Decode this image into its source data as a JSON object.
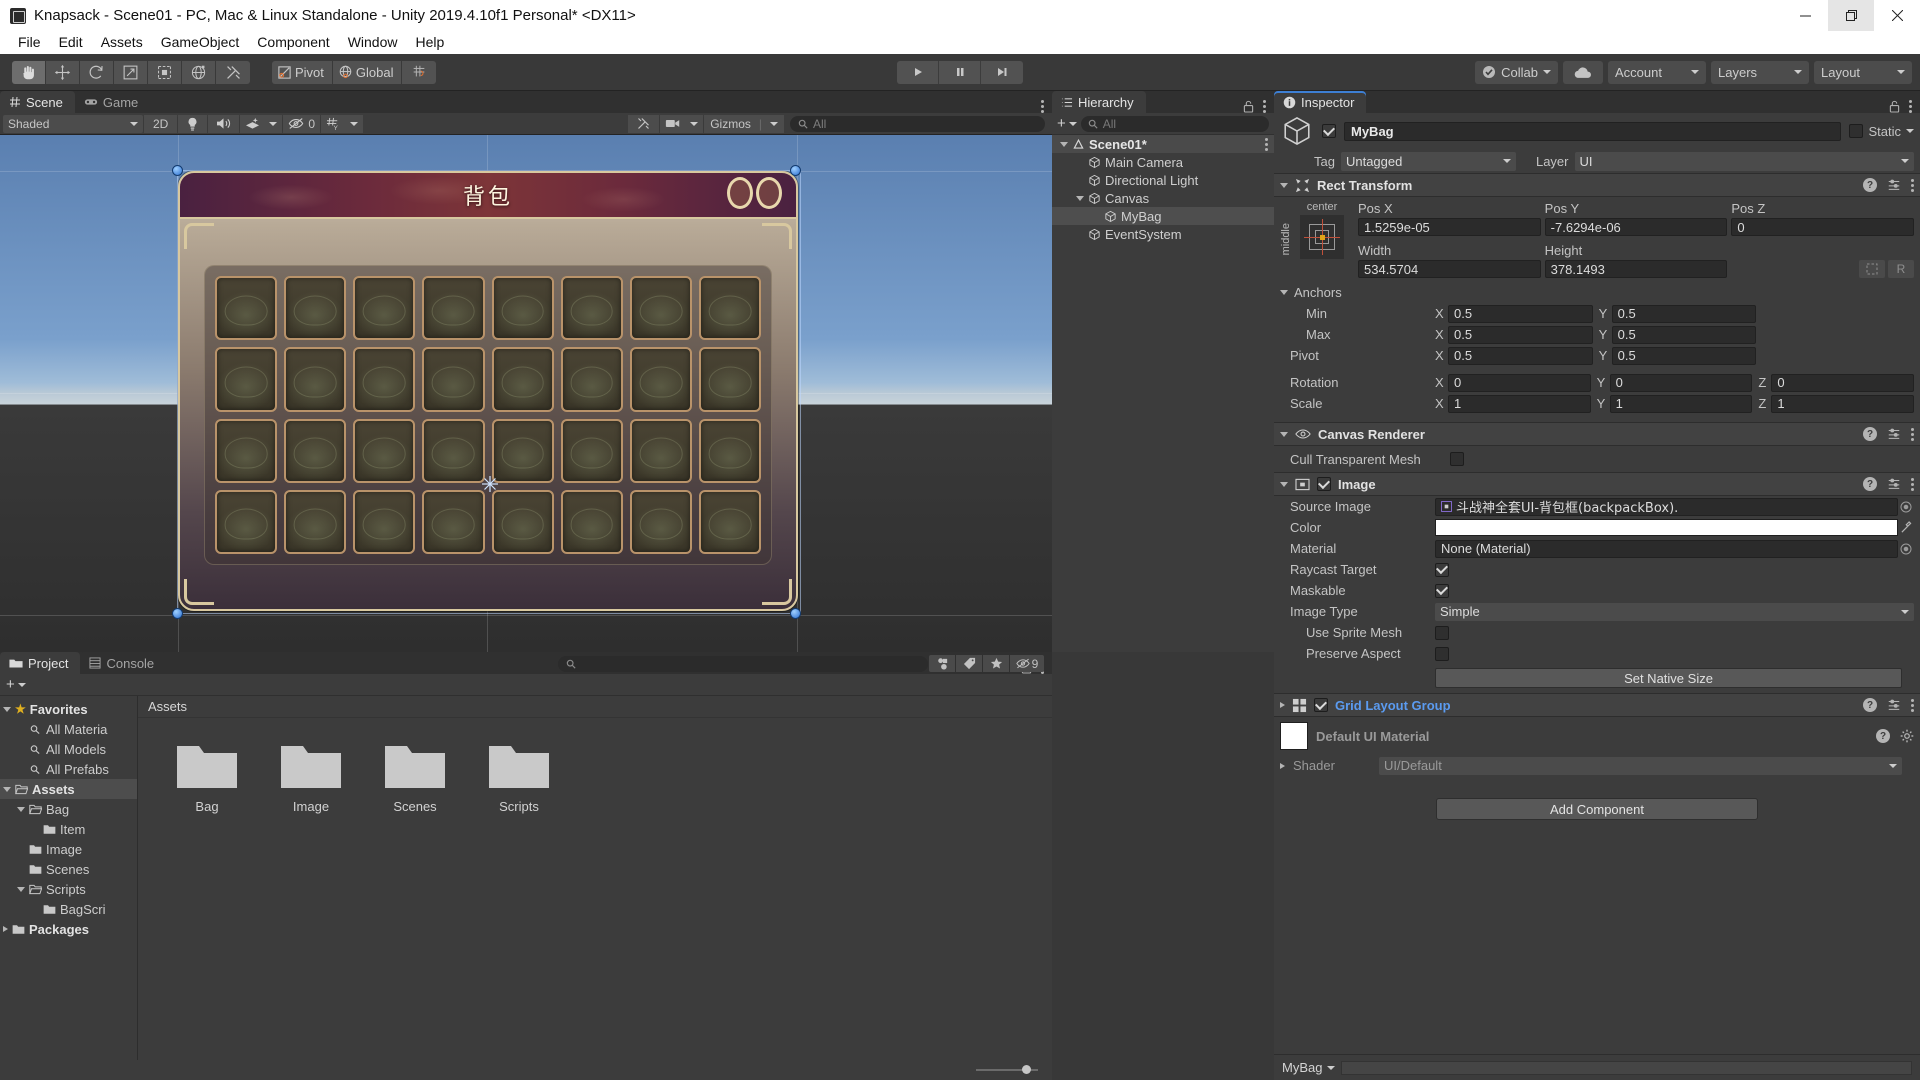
{
  "window": {
    "title": "Knapsack - Scene01 - PC, Mac & Linux Standalone - Unity 2019.4.10f1 Personal* <DX11>",
    "app_icon": "unity-icon",
    "minimize": "minimize-icon",
    "restore": "restore-icon",
    "close": "close-icon"
  },
  "menubar": {
    "items": [
      "File",
      "Edit",
      "Assets",
      "GameObject",
      "Component",
      "Window",
      "Help"
    ]
  },
  "toolbar": {
    "tools": [
      {
        "name": "hand-tool",
        "icon": "hand-icon",
        "active": true
      },
      {
        "name": "move-tool",
        "icon": "move-icon",
        "active": false
      },
      {
        "name": "rotate-tool",
        "icon": "rotate-icon",
        "active": false
      },
      {
        "name": "scale-tool",
        "icon": "scale-icon",
        "active": false
      },
      {
        "name": "rect-tool",
        "icon": "rect-icon",
        "active": false
      },
      {
        "name": "transform-tool",
        "icon": "transform-icon",
        "active": false
      },
      {
        "name": "custom-editor-tool",
        "icon": "wrench-icon",
        "active": false
      }
    ],
    "pivot_label": "Pivot",
    "global_label": "Global",
    "grid_snap_icon": "grid-snap-icon",
    "play": "play-icon",
    "pause": "pause-icon",
    "step": "step-icon",
    "collab_label": "Collab",
    "cloud_icon": "cloud-icon",
    "account_label": "Account",
    "layers_label": "Layers",
    "layout_label": "Layout"
  },
  "scene": {
    "tabs": [
      {
        "label": "Scene",
        "icon": "grid-hash-icon",
        "active": true
      },
      {
        "label": "Game",
        "icon": "gamepad-icon",
        "active": false
      }
    ],
    "draw_mode": "Shaded",
    "mode_2d": "2D",
    "lighting_icon": "lightbulb-icon",
    "audio_icon": "speaker-icon",
    "fx_icon": "fx-icon",
    "hidden_count": "0",
    "grid_icon": "grid-y-icon",
    "effects_icon": "wrench-icon",
    "camera_icon": "camera-icon",
    "gizmos_label": "Gizmos",
    "search_placeholder": "All",
    "search_value": "",
    "bag_ui": {
      "title": "背包",
      "slot_count": 32,
      "columns": 8,
      "rows": 4
    }
  },
  "hierarchy": {
    "tab_label": "Hierarchy",
    "tab_icon": "hierarchy-icon",
    "lock_icon": "lock-icon",
    "menu_icon": "kebab-icon",
    "add_label": "+",
    "search_placeholder": "All",
    "search_value": "",
    "items": [
      {
        "label": "Scene01*",
        "depth": 0,
        "icon": "unity-scene-icon",
        "expanded": true,
        "selected": false
      },
      {
        "label": "Main Camera",
        "depth": 1,
        "icon": "gameobject-icon",
        "expanded": null,
        "selected": false
      },
      {
        "label": "Directional Light",
        "depth": 1,
        "icon": "gameobject-icon",
        "expanded": null,
        "selected": false
      },
      {
        "label": "Canvas",
        "depth": 1,
        "icon": "gameobject-icon",
        "expanded": true,
        "selected": false
      },
      {
        "label": "MyBag",
        "depth": 2,
        "icon": "gameobject-icon",
        "expanded": null,
        "selected": true
      },
      {
        "label": "EventSystem",
        "depth": 1,
        "icon": "gameobject-icon",
        "expanded": null,
        "selected": false
      }
    ]
  },
  "inspector": {
    "tab_label": "Inspector",
    "tab_icon": "info-icon",
    "lock_icon": "lock-icon",
    "menu_icon": "kebab-icon",
    "object_name": "MyBag",
    "object_enabled": true,
    "static_label": "Static",
    "tag_label": "Tag",
    "tag_value": "Untagged",
    "layer_label": "Layer",
    "layer_value": "UI",
    "rect_transform": {
      "title": "Rect Transform",
      "anchor_preset_top": "center",
      "anchor_preset_side": "middle",
      "pos_x_label": "Pos X",
      "pos_x_value": "1.5259e-05",
      "pos_y_label": "Pos Y",
      "pos_y_value": "-7.6294e-06",
      "pos_z_label": "Pos Z",
      "pos_z_value": "0",
      "width_label": "Width",
      "width_value": "534.5704",
      "height_label": "Height",
      "height_value": "378.1493",
      "blueprint_icon": "blueprint-icon",
      "raw_icon": "R",
      "anchors_label": "Anchors",
      "min_label": "Min",
      "min_x": "0.5",
      "min_y": "0.5",
      "max_label": "Max",
      "max_x": "0.5",
      "max_y": "0.5",
      "pivot_label": "Pivot",
      "pivot_x": "0.5",
      "pivot_y": "0.5",
      "rotation_label": "Rotation",
      "rot_x": "0",
      "rot_y": "0",
      "rot_z": "0",
      "scale_label": "Scale",
      "scale_x": "1",
      "scale_y": "1",
      "scale_z": "1"
    },
    "canvas_renderer": {
      "title": "Canvas Renderer",
      "cull_label": "Cull Transparent Mesh",
      "cull_checked": false
    },
    "image": {
      "title": "Image",
      "enabled": true,
      "source_image_label": "Source Image",
      "source_image_value": "斗战神全套UI-背包框(backpackBox).",
      "color_label": "Color",
      "color_value": "#FFFFFF",
      "material_label": "Material",
      "material_value": "None (Material)",
      "raycast_label": "Raycast Target",
      "raycast_checked": true,
      "maskable_label": "Maskable",
      "maskable_checked": true,
      "image_type_label": "Image Type",
      "image_type_value": "Simple",
      "use_sprite_mesh_label": "Use Sprite Mesh",
      "use_sprite_mesh_checked": false,
      "preserve_aspect_label": "Preserve Aspect",
      "preserve_aspect_checked": false,
      "set_native_size_label": "Set Native Size"
    },
    "grid_layout_group": {
      "title": "Grid Layout Group",
      "enabled": true,
      "expanded": false
    },
    "material_preview": {
      "title": "Default UI Material",
      "shader_label": "Shader",
      "shader_value": "UI/Default"
    },
    "add_component_label": "Add Component",
    "footer_object": "MyBag"
  },
  "project": {
    "tabs": [
      {
        "label": "Project",
        "icon": "folder-icon",
        "active": true
      },
      {
        "label": "Console",
        "icon": "console-icon",
        "active": false
      }
    ],
    "lock_icon": "lock-icon",
    "menu_icon": "kebab-icon",
    "add_label": "+",
    "search_placeholder": "",
    "search_value": "",
    "filter_icons": [
      "asset-filter-icon",
      "label-filter-icon",
      "favorite-filter-icon"
    ],
    "hidden_badge": "9",
    "tree": [
      {
        "label": "Favorites",
        "depth": 0,
        "icon": "star-icon",
        "expanded": true,
        "bold": true,
        "selected": false
      },
      {
        "label": "All Materia",
        "depth": 1,
        "icon": "search-icon",
        "expanded": null,
        "bold": false,
        "selected": false
      },
      {
        "label": "All Models",
        "depth": 1,
        "icon": "search-icon",
        "expanded": null,
        "bold": false,
        "selected": false
      },
      {
        "label": "All Prefabs",
        "depth": 1,
        "icon": "search-icon",
        "expanded": null,
        "bold": false,
        "selected": false
      },
      {
        "label": "Assets",
        "depth": 0,
        "icon": "folder-open-icon",
        "expanded": true,
        "bold": true,
        "selected": true
      },
      {
        "label": "Bag",
        "depth": 1,
        "icon": "folder-open-icon",
        "expanded": true,
        "bold": false,
        "selected": false
      },
      {
        "label": "Item",
        "depth": 2,
        "icon": "folder-icon",
        "expanded": null,
        "bold": false,
        "selected": false
      },
      {
        "label": "Image",
        "depth": 1,
        "icon": "folder-icon",
        "expanded": null,
        "bold": false,
        "selected": false
      },
      {
        "label": "Scenes",
        "depth": 1,
        "icon": "folder-icon",
        "expanded": null,
        "bold": false,
        "selected": false
      },
      {
        "label": "Scripts",
        "depth": 1,
        "icon": "folder-open-icon",
        "expanded": true,
        "bold": false,
        "selected": false
      },
      {
        "label": "BagScri",
        "depth": 2,
        "icon": "folder-icon",
        "expanded": null,
        "bold": false,
        "selected": false
      },
      {
        "label": "Packages",
        "depth": 0,
        "icon": "folder-icon",
        "expanded": false,
        "bold": true,
        "selected": false
      }
    ],
    "breadcrumb": "Assets",
    "assets": [
      {
        "label": "Bag",
        "icon": "folder-icon"
      },
      {
        "label": "Image",
        "icon": "folder-icon"
      },
      {
        "label": "Scenes",
        "icon": "folder-icon"
      },
      {
        "label": "Scripts",
        "icon": "folder-icon"
      }
    ]
  },
  "colors": {
    "accent_blue": "#3d7fd4",
    "panel_bg": "#3c3c3c",
    "toolbar_bg": "#393939",
    "field_bg": "#2b2b2b",
    "link_blue": "#5b9bf0"
  }
}
